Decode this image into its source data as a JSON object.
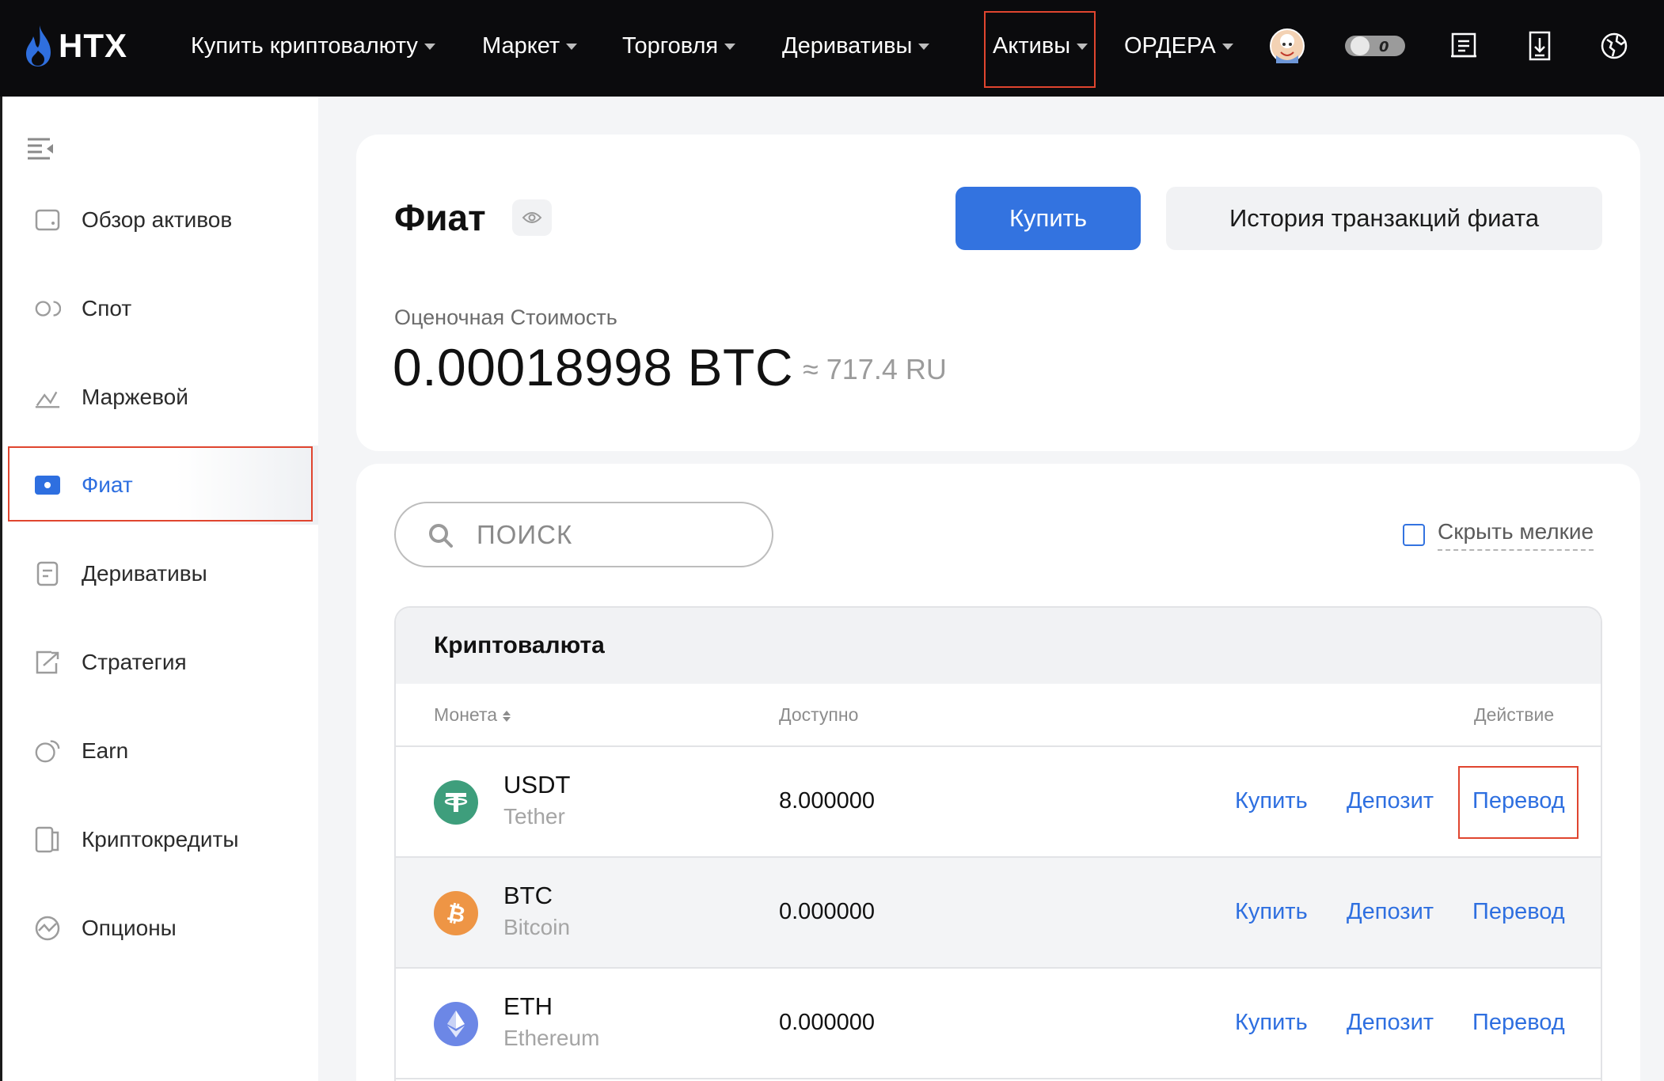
{
  "header": {
    "logo_text": "HTX",
    "nav": [
      {
        "label": "Купить криптовалюту",
        "has_caret": true
      },
      {
        "label": "Маркет",
        "has_caret": true
      },
      {
        "label": "Торговля",
        "has_caret": true
      },
      {
        "label": "Деривативы",
        "has_caret": true
      },
      {
        "label": "Активы",
        "has_caret": true
      },
      {
        "label": "ОРДЕРА",
        "has_caret": true
      }
    ],
    "icons": [
      "avatar",
      "toggle-icon",
      "orders-icon",
      "download-icon",
      "language-icon"
    ],
    "toggle_value": "0"
  },
  "sidebar": {
    "items": [
      {
        "label": "Обзор активов",
        "icon": "wallet-icon"
      },
      {
        "label": "Спот",
        "icon": "spot-icon"
      },
      {
        "label": "Маржевой",
        "icon": "margin-icon"
      },
      {
        "label": "Фиат",
        "icon": "fiat-icon",
        "active": true
      },
      {
        "label": "Деривативы",
        "icon": "derivatives-icon"
      },
      {
        "label": "Стратегия",
        "icon": "strategy-icon"
      },
      {
        "label": "Earn",
        "icon": "earn-icon"
      },
      {
        "label": "Криптокредиты",
        "icon": "loans-icon"
      },
      {
        "label": "Опционы",
        "icon": "options-icon"
      }
    ]
  },
  "summary": {
    "title": "Фиат",
    "buy_label": "Купить",
    "history_label": "История транзакций фиата",
    "estimated_label": "Оценочная Стоимость",
    "estimated_value": "0.00018998 BTC",
    "estimated_fiat": "≈ 717.4 RU"
  },
  "list": {
    "search_placeholder": "ПОИСК",
    "hide_small_label": "Скрыть мелкие",
    "section_title": "Криптовалюта",
    "columns": {
      "coin": "Монета",
      "available": "Доступно",
      "action": "Действие"
    },
    "actions": {
      "buy": "Купить",
      "deposit": "Депозит",
      "transfer": "Перевод"
    },
    "rows": [
      {
        "symbol": "USDT",
        "name": "Tether",
        "available": "8.000000",
        "icon_color": "#3e9e7c"
      },
      {
        "symbol": "BTC",
        "name": "Bitcoin",
        "available": "0.000000",
        "icon_color": "#ee9545"
      },
      {
        "symbol": "ETH",
        "name": "Ethereum",
        "available": "0.000000",
        "icon_color": "#6c87e6"
      }
    ]
  },
  "colors": {
    "accent": "#3373e0",
    "highlight_box": "#e0452f",
    "topbar": "#0b0b0d"
  }
}
